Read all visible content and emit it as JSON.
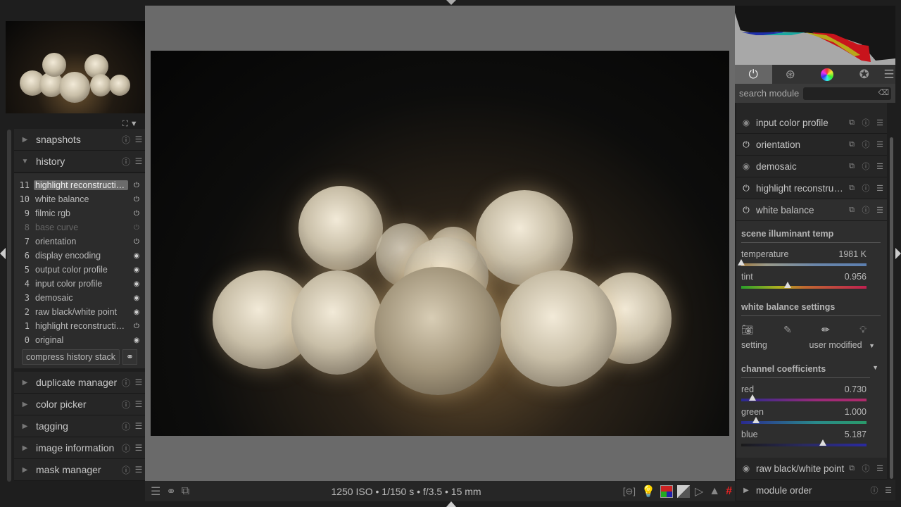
{
  "left_panel": {
    "modules": [
      {
        "label": "snapshots",
        "expanded": false
      },
      {
        "label": "history",
        "expanded": true
      }
    ],
    "history": [
      {
        "n": "11",
        "label": "highlight reconstructi…",
        "icon": "power",
        "selected": true
      },
      {
        "n": "10",
        "label": "white balance",
        "icon": "power"
      },
      {
        "n": "9",
        "label": "filmic rgb",
        "icon": "power"
      },
      {
        "n": "8",
        "label": "base curve",
        "icon": "power",
        "disabled": true
      },
      {
        "n": "7",
        "label": "orientation",
        "icon": "power"
      },
      {
        "n": "6",
        "label": "display encoding",
        "icon": "always-on"
      },
      {
        "n": "5",
        "label": "output color profile",
        "icon": "always-on"
      },
      {
        "n": "4",
        "label": "input color profile",
        "icon": "always-on"
      },
      {
        "n": "3",
        "label": "demosaic",
        "icon": "always-on"
      },
      {
        "n": "2",
        "label": "raw black/white point",
        "icon": "always-on"
      },
      {
        "n": "1",
        "label": "highlight reconstructi…",
        "icon": "power"
      },
      {
        "n": "0",
        "label": "original",
        "icon": "always-on"
      }
    ],
    "compress_label": "compress history stack",
    "lower_modules": [
      "duplicate manager",
      "color picker",
      "tagging",
      "image information",
      "mask manager"
    ]
  },
  "bottom": {
    "exif": "1250 ISO • 1/150 s • f/3.5 • 15 mm"
  },
  "right_panel": {
    "search_label": "search module",
    "search_value": "",
    "modules": [
      {
        "label": "input color profile",
        "icon": "always-on"
      },
      {
        "label": "orientation",
        "icon": "power"
      },
      {
        "label": "demosaic",
        "icon": "always-on"
      },
      {
        "label": "highlight reconstruc…",
        "icon": "power"
      },
      {
        "label": "white balance",
        "icon": "power"
      }
    ],
    "white_balance": {
      "sec1": "scene illuminant temp",
      "temperature": {
        "label": "temperature",
        "value": "1981 K",
        "pos": 0.0
      },
      "tint": {
        "label": "tint",
        "value": "0.956",
        "pos": 0.37
      },
      "sec2": "white balance settings",
      "setting_label": "setting",
      "setting_value": "user modified",
      "sec3": "channel coefficients",
      "red": {
        "label": "red",
        "value": "0.730",
        "pos": 0.09
      },
      "green": {
        "label": "green",
        "value": "1.000",
        "pos": 0.12
      },
      "blue": {
        "label": "blue",
        "value": "5.187",
        "pos": 0.65
      }
    },
    "after": {
      "label": "raw black/white point",
      "icon": "always-on"
    },
    "module_order": "module order"
  }
}
